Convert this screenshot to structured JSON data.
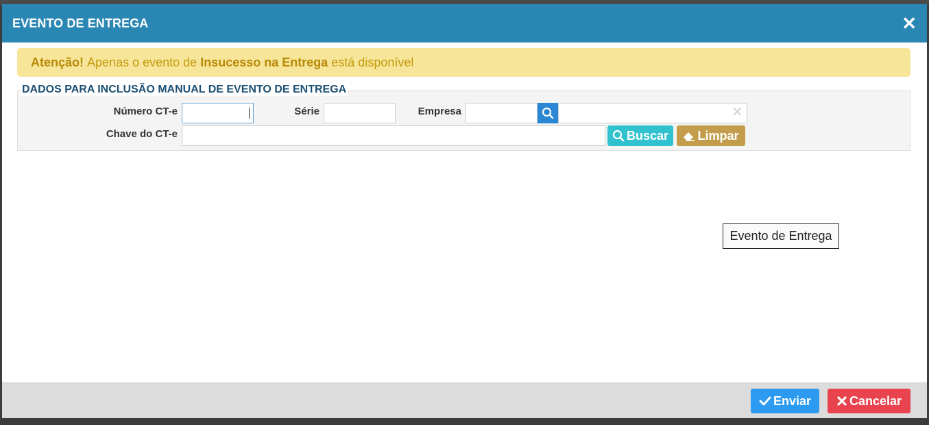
{
  "modal": {
    "title": "EVENTO DE ENTREGA",
    "close_icon": "close-icon",
    "alert": {
      "prefix": "Atenção!",
      "text_before": "Apenas o evento de",
      "highlight": "Insucesso na Entrega",
      "text_after": "está disponível"
    },
    "form": {
      "legend": "DADOS PARA INCLUSÃO MANUAL DE EVENTO DE ENTREGA",
      "numero_label": "Número CT-e",
      "numero_value": "",
      "serie_label": "Série",
      "serie_value": "",
      "empresa_label": "Empresa",
      "empresa_value": "",
      "empresa_name_value": "",
      "chave_label": "Chave do CT-e",
      "chave_value": "",
      "buscar_label": "Buscar",
      "limpar_label": "Limpar"
    },
    "tooltip": "Evento de Entrega",
    "footer": {
      "enviar_label": "Enviar",
      "cancelar_label": "Cancelar"
    }
  },
  "colors": {
    "header": "#2a87b4",
    "alert_bg": "#f7e59a",
    "buscar": "#32c2cf",
    "limpar": "#c39d4b",
    "enviar": "#2b9af0",
    "cancelar": "#e8434f"
  }
}
